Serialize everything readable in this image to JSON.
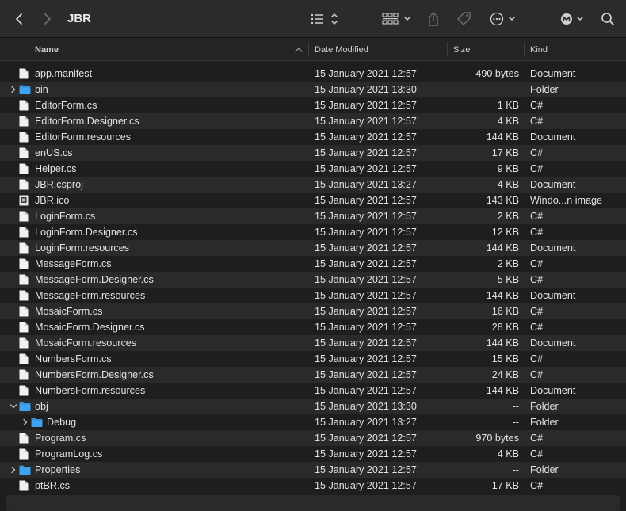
{
  "window": {
    "title": "JBR"
  },
  "toolbar": {
    "icons": [
      "back-icon",
      "forward-icon",
      "list-view-icon",
      "group-icon",
      "share-icon",
      "tag-icon",
      "more-icon",
      "account-icon",
      "search-icon"
    ]
  },
  "columns": {
    "name": "Name",
    "date": "Date Modified",
    "size": "Size",
    "kind": "Kind"
  },
  "files": [
    {
      "name": "app.manifest",
      "date": "15 January 2021 12:57",
      "size": "490 bytes",
      "kind": "Document",
      "icon": "file",
      "level": 0
    },
    {
      "name": "bin",
      "date": "15 January 2021 13:30",
      "size": "--",
      "kind": "Folder",
      "icon": "folder",
      "level": 0,
      "disclosure": "collapsed"
    },
    {
      "name": "EditorForm.cs",
      "date": "15 January 2021 12:57",
      "size": "1 KB",
      "kind": "C#",
      "icon": "file",
      "level": 0
    },
    {
      "name": "EditorForm.Designer.cs",
      "date": "15 January 2021 12:57",
      "size": "4 KB",
      "kind": "C#",
      "icon": "file",
      "level": 0
    },
    {
      "name": "EditorForm.resources",
      "date": "15 January 2021 12:57",
      "size": "144 KB",
      "kind": "Document",
      "icon": "file",
      "level": 0
    },
    {
      "name": "enUS.cs",
      "date": "15 January 2021 12:57",
      "size": "17 KB",
      "kind": "C#",
      "icon": "file",
      "level": 0
    },
    {
      "name": "Helper.cs",
      "date": "15 January 2021 12:57",
      "size": "9 KB",
      "kind": "C#",
      "icon": "file",
      "level": 0
    },
    {
      "name": "JBR.csproj",
      "date": "15 January 2021 13:27",
      "size": "4 KB",
      "kind": "Document",
      "icon": "file",
      "level": 0
    },
    {
      "name": "JBR.ico",
      "date": "15 January 2021 12:57",
      "size": "143 KB",
      "kind": "Windo...n image",
      "icon": "image",
      "level": 0
    },
    {
      "name": "LoginForm.cs",
      "date": "15 January 2021 12:57",
      "size": "2 KB",
      "kind": "C#",
      "icon": "file",
      "level": 0
    },
    {
      "name": "LoginForm.Designer.cs",
      "date": "15 January 2021 12:57",
      "size": "12 KB",
      "kind": "C#",
      "icon": "file",
      "level": 0
    },
    {
      "name": "LoginForm.resources",
      "date": "15 January 2021 12:57",
      "size": "144 KB",
      "kind": "Document",
      "icon": "file",
      "level": 0
    },
    {
      "name": "MessageForm.cs",
      "date": "15 January 2021 12:57",
      "size": "2 KB",
      "kind": "C#",
      "icon": "file",
      "level": 0
    },
    {
      "name": "MessageForm.Designer.cs",
      "date": "15 January 2021 12:57",
      "size": "5 KB",
      "kind": "C#",
      "icon": "file",
      "level": 0
    },
    {
      "name": "MessageForm.resources",
      "date": "15 January 2021 12:57",
      "size": "144 KB",
      "kind": "Document",
      "icon": "file",
      "level": 0
    },
    {
      "name": "MosaicForm.cs",
      "date": "15 January 2021 12:57",
      "size": "16 KB",
      "kind": "C#",
      "icon": "file",
      "level": 0
    },
    {
      "name": "MosaicForm.Designer.cs",
      "date": "15 January 2021 12:57",
      "size": "28 KB",
      "kind": "C#",
      "icon": "file",
      "level": 0
    },
    {
      "name": "MosaicForm.resources",
      "date": "15 January 2021 12:57",
      "size": "144 KB",
      "kind": "Document",
      "icon": "file",
      "level": 0
    },
    {
      "name": "NumbersForm.cs",
      "date": "15 January 2021 12:57",
      "size": "15 KB",
      "kind": "C#",
      "icon": "file",
      "level": 0
    },
    {
      "name": "NumbersForm.Designer.cs",
      "date": "15 January 2021 12:57",
      "size": "24 KB",
      "kind": "C#",
      "icon": "file",
      "level": 0
    },
    {
      "name": "NumbersForm.resources",
      "date": "15 January 2021 12:57",
      "size": "144 KB",
      "kind": "Document",
      "icon": "file",
      "level": 0
    },
    {
      "name": "obj",
      "date": "15 January 2021 13:30",
      "size": "--",
      "kind": "Folder",
      "icon": "folder",
      "level": 0,
      "disclosure": "expanded"
    },
    {
      "name": "Debug",
      "date": "15 January 2021 13:27",
      "size": "--",
      "kind": "Folder",
      "icon": "folder",
      "level": 1,
      "disclosure": "collapsed"
    },
    {
      "name": "Program.cs",
      "date": "15 January 2021 12:57",
      "size": "970 bytes",
      "kind": "C#",
      "icon": "file",
      "level": 0
    },
    {
      "name": "ProgramLog.cs",
      "date": "15 January 2021 12:57",
      "size": "4 KB",
      "kind": "C#",
      "icon": "file",
      "level": 0
    },
    {
      "name": "Properties",
      "date": "15 January 2021 12:57",
      "size": "--",
      "kind": "Folder",
      "icon": "folder",
      "level": 0,
      "disclosure": "collapsed"
    },
    {
      "name": "ptBR.cs",
      "date": "15 January 2021 12:57",
      "size": "17 KB",
      "kind": "C#",
      "icon": "file",
      "level": 0
    }
  ],
  "colors": {
    "folder": "#3ea4f0",
    "file": "#f2f2f2",
    "background": "#1e1e1e",
    "stripe": "#2a2a2a"
  }
}
